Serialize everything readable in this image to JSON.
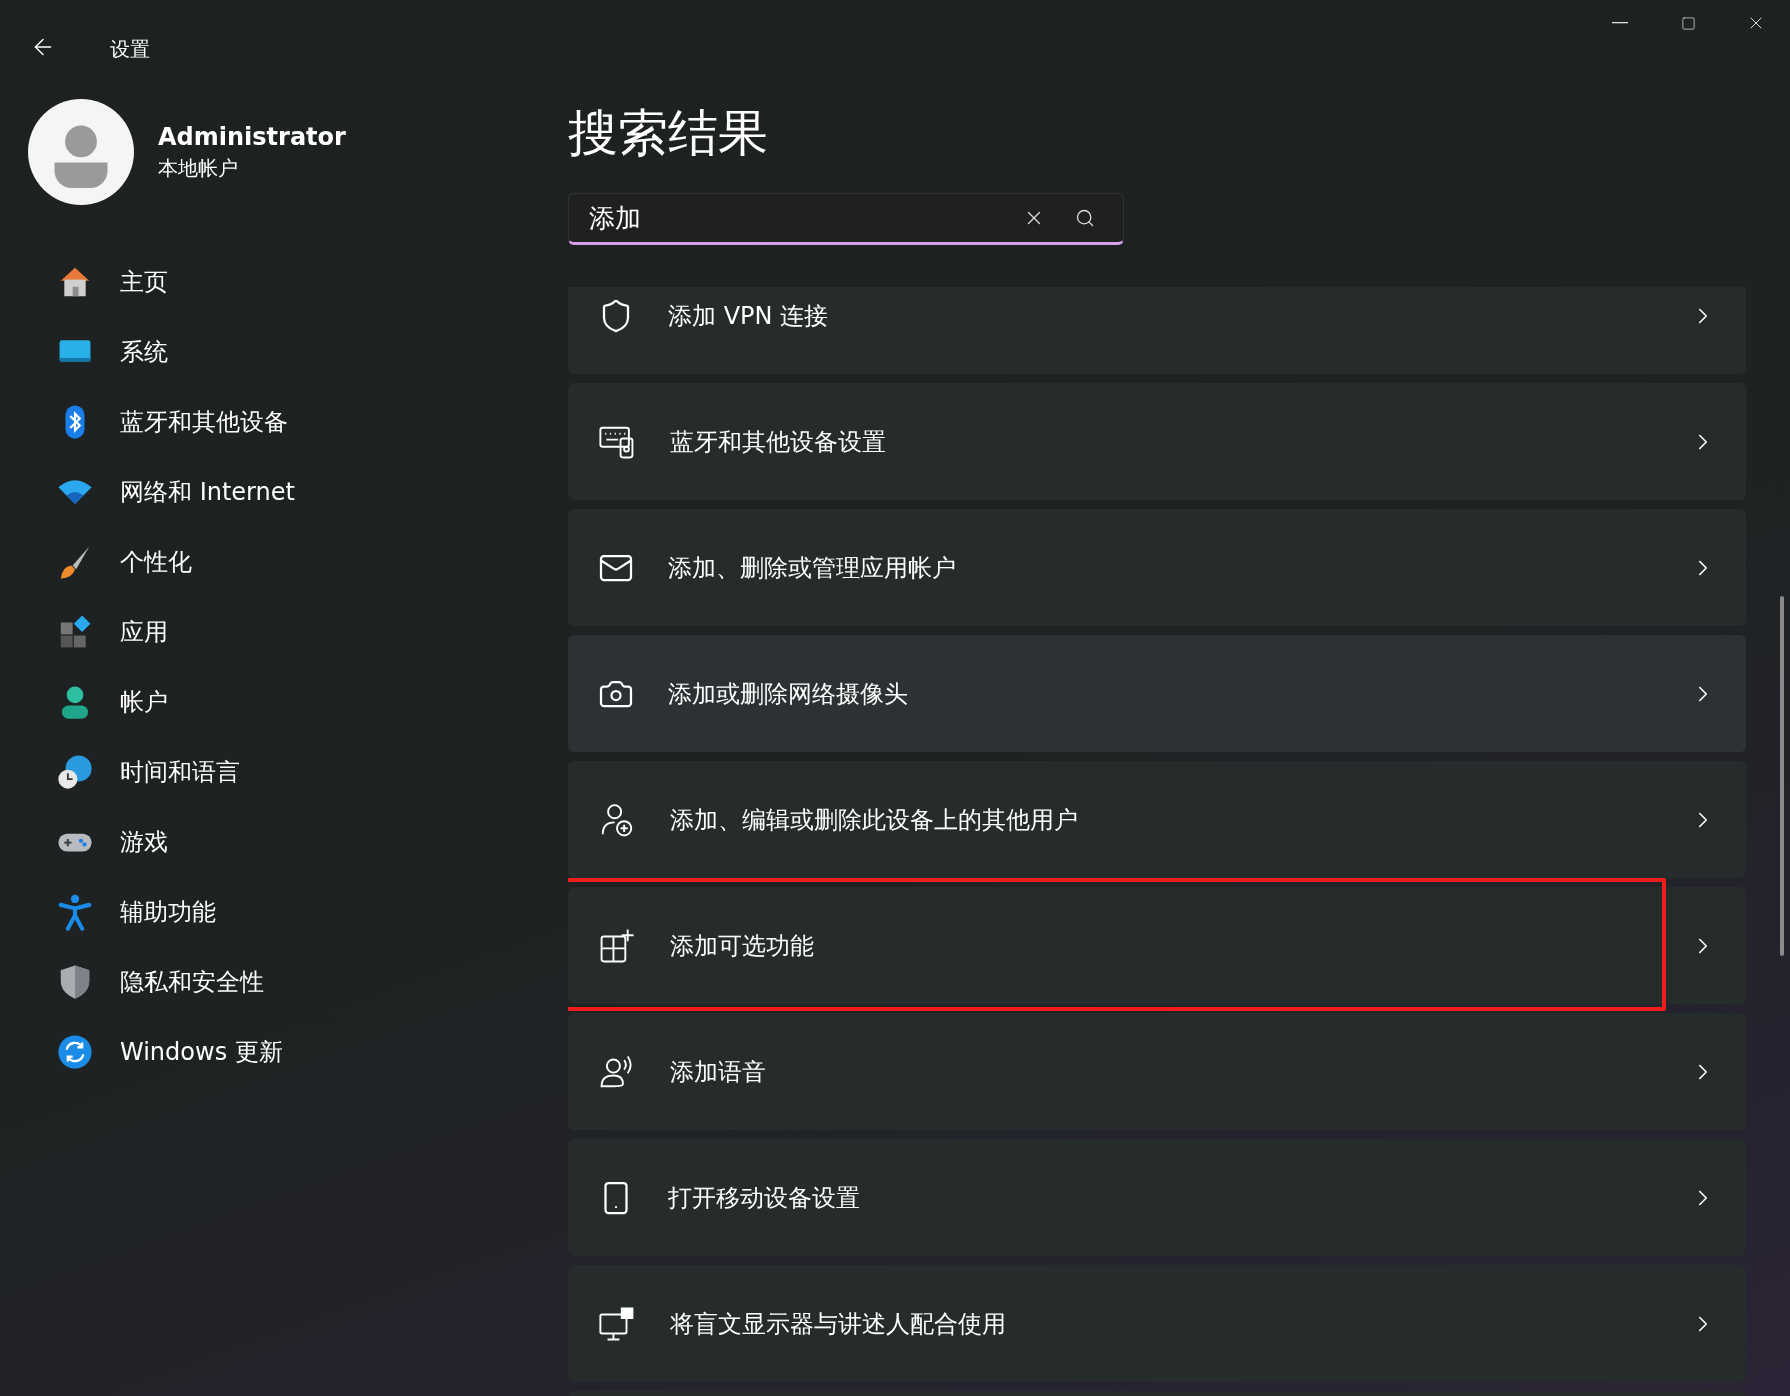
{
  "window": {
    "title": "设置"
  },
  "account": {
    "name": "Administrator",
    "type": "本地帐户"
  },
  "sidebar": {
    "items": [
      {
        "label": "主页"
      },
      {
        "label": "系统"
      },
      {
        "label": "蓝牙和其他设备"
      },
      {
        "label": "网络和 Internet"
      },
      {
        "label": "个性化"
      },
      {
        "label": "应用"
      },
      {
        "label": "帐户"
      },
      {
        "label": "时间和语言"
      },
      {
        "label": "游戏"
      },
      {
        "label": "辅助功能"
      },
      {
        "label": "隐私和安全性"
      },
      {
        "label": "Windows 更新"
      }
    ]
  },
  "page": {
    "title": "搜索结果"
  },
  "search": {
    "value": "添加"
  },
  "results": [
    {
      "label": "添加 VPN 连接",
      "hovered": false,
      "highlighted": false
    },
    {
      "label": "蓝牙和其他设备设置",
      "hovered": false,
      "highlighted": false
    },
    {
      "label": "添加、删除或管理应用帐户",
      "hovered": false,
      "highlighted": false
    },
    {
      "label": "添加或删除网络摄像头",
      "hovered": true,
      "highlighted": false
    },
    {
      "label": "添加、编辑或删除此设备上的其他用户",
      "hovered": false,
      "highlighted": false
    },
    {
      "label": "添加可选功能",
      "hovered": false,
      "highlighted": true
    },
    {
      "label": "添加语音",
      "hovered": false,
      "highlighted": false
    },
    {
      "label": "打开移动设备设置",
      "hovered": false,
      "highlighted": false
    },
    {
      "label": "将盲文显示器与讲述人配合使用",
      "hovered": false,
      "highlighted": false
    }
  ]
}
